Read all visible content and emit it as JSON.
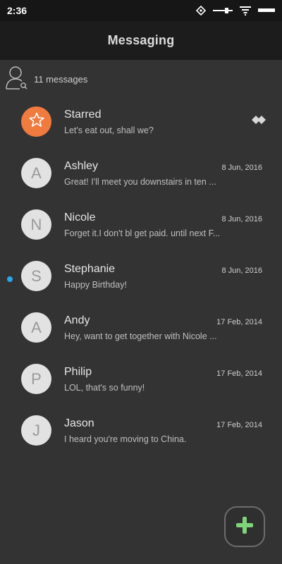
{
  "colors": {
    "background": "#333333",
    "starred_avatar": "#ef7b3f",
    "unread_dot": "#2aa6ee",
    "fab_plus": "#7fd37a"
  },
  "status_bar": {
    "time": "2:36",
    "icons": [
      "data-saver-icon",
      "signal-slider-icon",
      "wifi-icon",
      "battery-icon"
    ]
  },
  "header": {
    "title": "Messaging"
  },
  "filter": {
    "count_label": "11 messages",
    "icon": "contact-search-icon"
  },
  "conversations": [
    {
      "initial": "",
      "name": "Starred",
      "preview": "Let's eat out, shall we?",
      "date": "",
      "starred": true,
      "unread": false
    },
    {
      "initial": "A",
      "name": "Ashley",
      "preview": "Great! I'll meet you downstairs in ten ...",
      "date": "8 Jun, 2016",
      "starred": false,
      "unread": false
    },
    {
      "initial": "N",
      "name": "Nicole",
      "preview": "Forget it.I don't bl get paid. until next F...",
      "date": "8 Jun, 2016",
      "starred": false,
      "unread": false
    },
    {
      "initial": "S",
      "name": "Stephanie",
      "preview": "Happy Birthday!",
      "date": "8 Jun, 2016",
      "starred": false,
      "unread": true
    },
    {
      "initial": "A",
      "name": "Andy",
      "preview": "Hey, want to get together with Nicole ...",
      "date": "17 Feb, 2014",
      "starred": false,
      "unread": false
    },
    {
      "initial": "P",
      "name": "Philip",
      "preview": "LOL, that's so funny!",
      "date": "17 Feb, 2014",
      "starred": false,
      "unread": false
    },
    {
      "initial": "J",
      "name": "Jason",
      "preview": "I heard you're moving to China.",
      "date": "17 Feb, 2014",
      "starred": false,
      "unread": false
    }
  ],
  "fab": {
    "icon": "plus-icon"
  }
}
